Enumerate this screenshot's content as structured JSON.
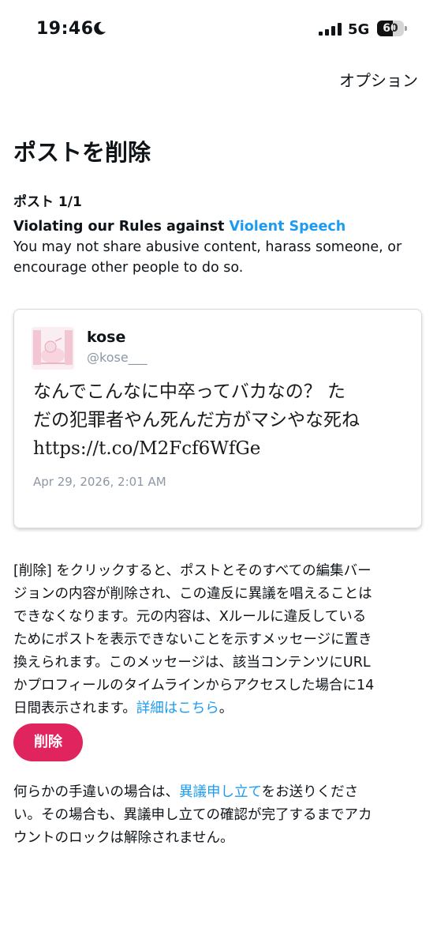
{
  "status_bar": {
    "time": "19:46",
    "network": "5G",
    "battery_level": "60",
    "battery_fraction": 0.6
  },
  "header": {
    "options_label": "オプション"
  },
  "page": {
    "title": "ポストを削除",
    "post_count": "ポスト 1/1"
  },
  "violation": {
    "heading_prefix": "Violating our Rules against ",
    "heading_link": "Violent Speech",
    "description": "You may not share abusive content, harass someone, or encourage other people to do so."
  },
  "post": {
    "author_name": "kose",
    "author_handle": "@kose___",
    "text_lines": [
      "なんでこんなに中卒ってバカなの？ た",
      "だの犯罪者やん死んだ方がマシやな死ね",
      "https://t.co/M2Fcf6WfGe"
    ],
    "date": "Apr 29, 2026, 2:01 AM"
  },
  "explanation": {
    "lines": [
      "[削除] をクリックすると、ポストとそのすべての編集バー",
      "ジョンの内容が削除され、この違反に異議を唱えることは",
      "できなくなります。元の内容は、Xルールに違反している",
      "ためにポストを表示できないことを示すメッセージに置き",
      "換えられます。このメッセージは、該当コンテンツにURL",
      "かプロフィールのタイムラインからアクセスした場合に14"
    ],
    "last_line_prefix": "日間表示されます。",
    "link": "詳細はこちら",
    "last_line_suffix": "。"
  },
  "delete_button": {
    "label": "削除"
  },
  "appeal": {
    "line1_prefix": "何らかの手違いの場合は、",
    "link": "異議申し立て",
    "line1_suffix": "をお送りくださ",
    "lines": [
      "い。その場合も、異議申し立ての確認が完了するまでアカ",
      "ウントのロックは解除されません。"
    ]
  },
  "colors": {
    "link": "#1d9bf0",
    "delete_button": "#e0245e",
    "muted_text": "#8b98a5"
  }
}
